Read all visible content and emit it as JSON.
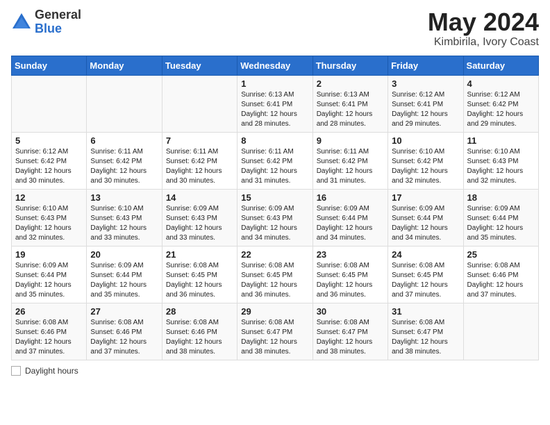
{
  "header": {
    "logo_general": "General",
    "logo_blue": "Blue",
    "month_year": "May 2024",
    "location": "Kimbirila, Ivory Coast"
  },
  "days_of_week": [
    "Sunday",
    "Monday",
    "Tuesday",
    "Wednesday",
    "Thursday",
    "Friday",
    "Saturday"
  ],
  "weeks": [
    [
      {
        "num": "",
        "info": ""
      },
      {
        "num": "",
        "info": ""
      },
      {
        "num": "",
        "info": ""
      },
      {
        "num": "1",
        "info": "Sunrise: 6:13 AM\nSunset: 6:41 PM\nDaylight: 12 hours\nand 28 minutes."
      },
      {
        "num": "2",
        "info": "Sunrise: 6:13 AM\nSunset: 6:41 PM\nDaylight: 12 hours\nand 28 minutes."
      },
      {
        "num": "3",
        "info": "Sunrise: 6:12 AM\nSunset: 6:41 PM\nDaylight: 12 hours\nand 29 minutes."
      },
      {
        "num": "4",
        "info": "Sunrise: 6:12 AM\nSunset: 6:42 PM\nDaylight: 12 hours\nand 29 minutes."
      }
    ],
    [
      {
        "num": "5",
        "info": "Sunrise: 6:12 AM\nSunset: 6:42 PM\nDaylight: 12 hours\nand 30 minutes."
      },
      {
        "num": "6",
        "info": "Sunrise: 6:11 AM\nSunset: 6:42 PM\nDaylight: 12 hours\nand 30 minutes."
      },
      {
        "num": "7",
        "info": "Sunrise: 6:11 AM\nSunset: 6:42 PM\nDaylight: 12 hours\nand 30 minutes."
      },
      {
        "num": "8",
        "info": "Sunrise: 6:11 AM\nSunset: 6:42 PM\nDaylight: 12 hours\nand 31 minutes."
      },
      {
        "num": "9",
        "info": "Sunrise: 6:11 AM\nSunset: 6:42 PM\nDaylight: 12 hours\nand 31 minutes."
      },
      {
        "num": "10",
        "info": "Sunrise: 6:10 AM\nSunset: 6:42 PM\nDaylight: 12 hours\nand 32 minutes."
      },
      {
        "num": "11",
        "info": "Sunrise: 6:10 AM\nSunset: 6:43 PM\nDaylight: 12 hours\nand 32 minutes."
      }
    ],
    [
      {
        "num": "12",
        "info": "Sunrise: 6:10 AM\nSunset: 6:43 PM\nDaylight: 12 hours\nand 32 minutes."
      },
      {
        "num": "13",
        "info": "Sunrise: 6:10 AM\nSunset: 6:43 PM\nDaylight: 12 hours\nand 33 minutes."
      },
      {
        "num": "14",
        "info": "Sunrise: 6:09 AM\nSunset: 6:43 PM\nDaylight: 12 hours\nand 33 minutes."
      },
      {
        "num": "15",
        "info": "Sunrise: 6:09 AM\nSunset: 6:43 PM\nDaylight: 12 hours\nand 34 minutes."
      },
      {
        "num": "16",
        "info": "Sunrise: 6:09 AM\nSunset: 6:44 PM\nDaylight: 12 hours\nand 34 minutes."
      },
      {
        "num": "17",
        "info": "Sunrise: 6:09 AM\nSunset: 6:44 PM\nDaylight: 12 hours\nand 34 minutes."
      },
      {
        "num": "18",
        "info": "Sunrise: 6:09 AM\nSunset: 6:44 PM\nDaylight: 12 hours\nand 35 minutes."
      }
    ],
    [
      {
        "num": "19",
        "info": "Sunrise: 6:09 AM\nSunset: 6:44 PM\nDaylight: 12 hours\nand 35 minutes."
      },
      {
        "num": "20",
        "info": "Sunrise: 6:09 AM\nSunset: 6:44 PM\nDaylight: 12 hours\nand 35 minutes."
      },
      {
        "num": "21",
        "info": "Sunrise: 6:08 AM\nSunset: 6:45 PM\nDaylight: 12 hours\nand 36 minutes."
      },
      {
        "num": "22",
        "info": "Sunrise: 6:08 AM\nSunset: 6:45 PM\nDaylight: 12 hours\nand 36 minutes."
      },
      {
        "num": "23",
        "info": "Sunrise: 6:08 AM\nSunset: 6:45 PM\nDaylight: 12 hours\nand 36 minutes."
      },
      {
        "num": "24",
        "info": "Sunrise: 6:08 AM\nSunset: 6:45 PM\nDaylight: 12 hours\nand 37 minutes."
      },
      {
        "num": "25",
        "info": "Sunrise: 6:08 AM\nSunset: 6:46 PM\nDaylight: 12 hours\nand 37 minutes."
      }
    ],
    [
      {
        "num": "26",
        "info": "Sunrise: 6:08 AM\nSunset: 6:46 PM\nDaylight: 12 hours\nand 37 minutes."
      },
      {
        "num": "27",
        "info": "Sunrise: 6:08 AM\nSunset: 6:46 PM\nDaylight: 12 hours\nand 37 minutes."
      },
      {
        "num": "28",
        "info": "Sunrise: 6:08 AM\nSunset: 6:46 PM\nDaylight: 12 hours\nand 38 minutes."
      },
      {
        "num": "29",
        "info": "Sunrise: 6:08 AM\nSunset: 6:47 PM\nDaylight: 12 hours\nand 38 minutes."
      },
      {
        "num": "30",
        "info": "Sunrise: 6:08 AM\nSunset: 6:47 PM\nDaylight: 12 hours\nand 38 minutes."
      },
      {
        "num": "31",
        "info": "Sunrise: 6:08 AM\nSunset: 6:47 PM\nDaylight: 12 hours\nand 38 minutes."
      },
      {
        "num": "",
        "info": ""
      }
    ]
  ],
  "footer": {
    "daylight_label": "Daylight hours"
  }
}
